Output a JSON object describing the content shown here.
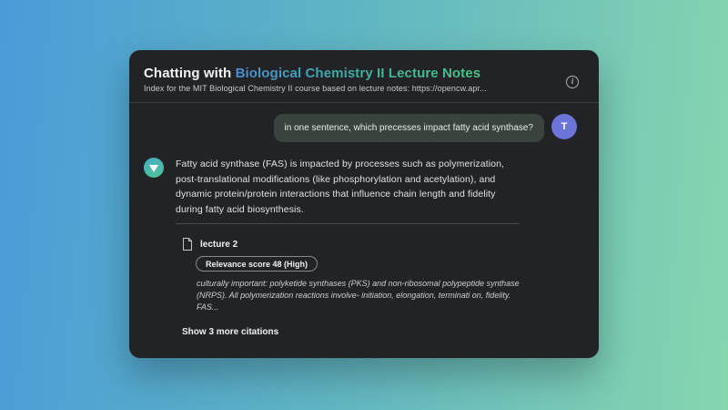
{
  "header": {
    "title_prefix": "Chatting with ",
    "title_subject": "Biological Chemistry II Lecture Notes",
    "subtitle": "Index for the MIT Biological Chemistry II course based on lecture notes: https://opencw.apr...",
    "title_gradient_start": "#4a8fd4",
    "title_gradient_end": "#4ec587"
  },
  "chat": {
    "user_message": {
      "text": "in one sentence, which precesses impact fatty acid synthase?",
      "avatar_initial": "T",
      "avatar_color": "#6b74d9",
      "bubble_color": "#39443d"
    },
    "assistant_message": {
      "text": "Fatty acid synthase (FAS) is impacted by processes such as polymerization, post-translational modifications (like phosphorylation and acetylation), and dynamic protein/protein interactions that influence chain length and fidelity during fatty acid biosynthesis.",
      "avatar_gradient_start": "#46aec6",
      "avatar_gradient_end": "#4fc394"
    },
    "citation": {
      "source": "lecture 2",
      "relevance_badge": "Relevance score 48 (High)",
      "snippet": "culturally important: polyketide synthases (PKS) and non-ribosomal polypeptide synthase (NRPS). All polymerization reactions involve- initiation, elongation, terminati on, fidelity. FAS...",
      "show_more_label": "Show 3 more citations"
    }
  },
  "page": {
    "bg_gradient_start": "#4a9cd8",
    "bg_gradient_end": "#86d6ae"
  }
}
